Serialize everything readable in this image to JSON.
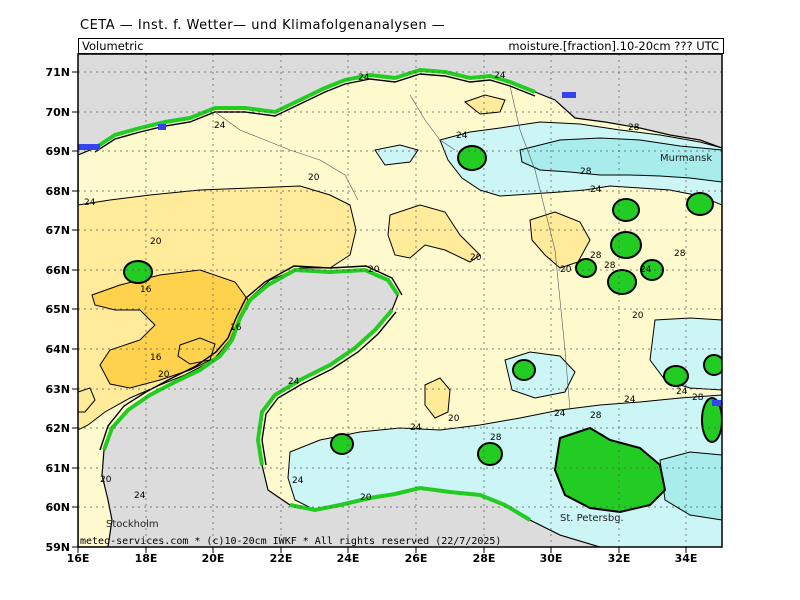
{
  "header": {
    "title": "CETA — Inst. f. Wetter— und Klimafolgenanalysen —",
    "variable_left": "Volumetric",
    "variable_right": "moisture.[fraction].10-20cm ??? UTC"
  },
  "footer": {
    "credit": "meteo-services.com * (c)10-20cm IWKF * All rights reserved (22/7/2025)"
  },
  "map": {
    "lat_ticks": [
      "71N",
      "70N",
      "69N",
      "68N",
      "67N",
      "66N",
      "65N",
      "64N",
      "63N",
      "62N",
      "61N",
      "60N",
      "59N"
    ],
    "lon_ticks": [
      "16E",
      "18E",
      "20E",
      "22E",
      "24E",
      "26E",
      "28E",
      "30E",
      "32E",
      "34E"
    ],
    "cities": [
      {
        "name": "Murmansk"
      },
      {
        "name": "Stockholm"
      },
      {
        "name": "St. Petersbg."
      }
    ],
    "contour_labels": [
      "24",
      "24",
      "24",
      "20",
      "20",
      "16",
      "16",
      "16",
      "20",
      "20",
      "24",
      "24",
      "28",
      "24",
      "20",
      "24",
      "28",
      "24",
      "28",
      "20",
      "20",
      "24",
      "28",
      "24",
      "24",
      "24",
      "28",
      "20",
      "28",
      "28",
      "24",
      "28",
      "20",
      "20",
      "24"
    ],
    "colors": {
      "land_gray": "#dcdcdc",
      "very_light_yellow": "#fffacd",
      "light_yellow": "#ffeb99",
      "orange_yellow": "#ffd24d",
      "light_cyan": "#ccf5f5",
      "cyan": "#a8ecec",
      "green": "#22cc22",
      "blue": "#3344ee"
    }
  }
}
